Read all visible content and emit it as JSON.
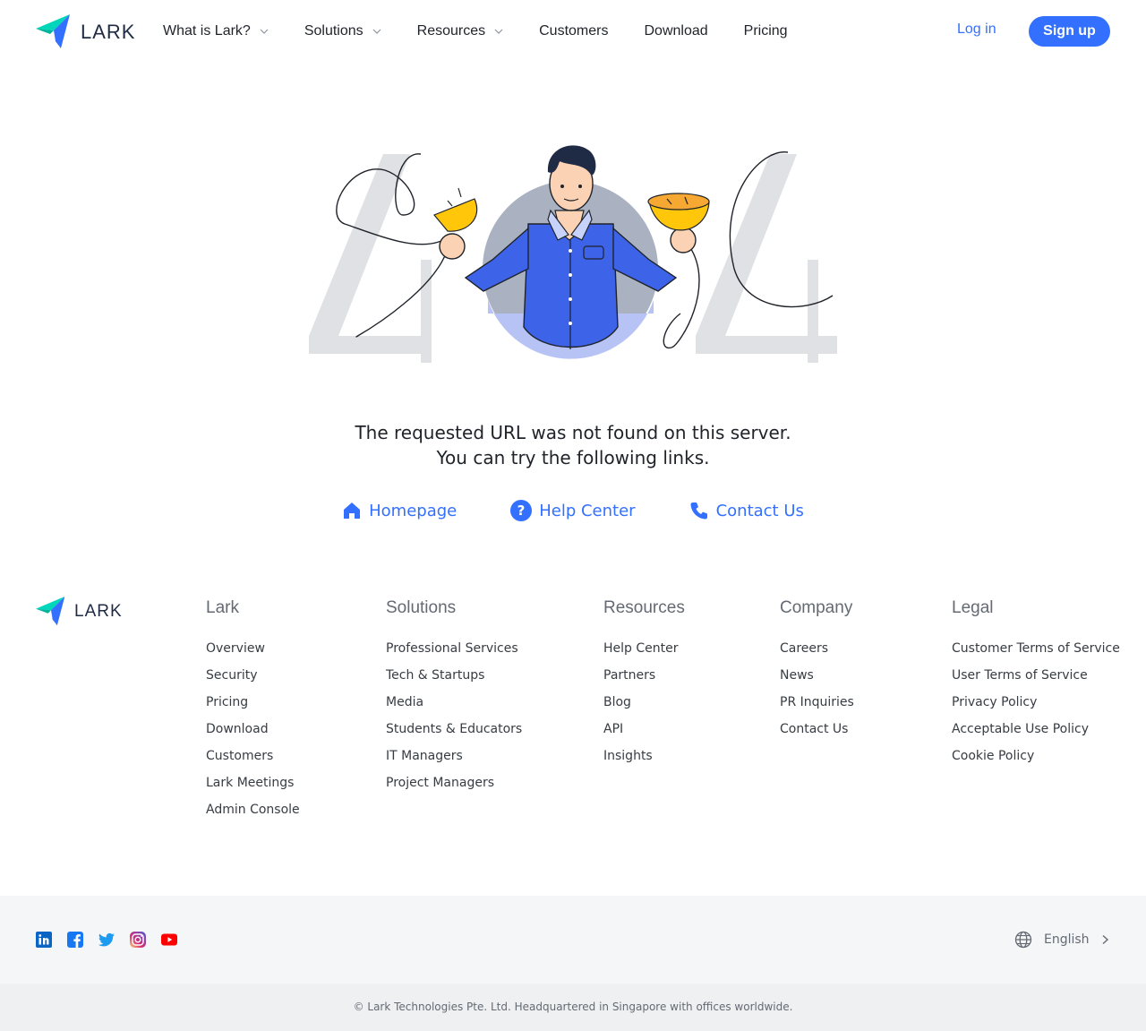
{
  "header": {
    "logo_text": "LARK",
    "nav": [
      {
        "label": "What is Lark?",
        "dropdown": true
      },
      {
        "label": "Solutions",
        "dropdown": true
      },
      {
        "label": "Resources",
        "dropdown": true
      },
      {
        "label": "Customers",
        "dropdown": false
      },
      {
        "label": "Download",
        "dropdown": false
      },
      {
        "label": "Pricing",
        "dropdown": false
      }
    ],
    "login_label": "Log in",
    "signup_label": "Sign up"
  },
  "error": {
    "line1": "The requested URL was not found on this server.",
    "line2": "You can try the following links.",
    "links": [
      {
        "label": "Homepage",
        "icon": "home-icon"
      },
      {
        "label": "Help Center",
        "icon": "question-icon"
      },
      {
        "label": "Contact Us",
        "icon": "phone-icon"
      }
    ]
  },
  "footer": {
    "logo_text": "LARK",
    "columns": [
      {
        "title": "Lark",
        "items": [
          "Overview",
          "Security",
          "Pricing",
          "Download",
          "Customers",
          "Lark Meetings",
          "Admin Console"
        ]
      },
      {
        "title": "Solutions",
        "items": [
          "Professional Services",
          "Tech & Startups",
          "Media",
          "Students & Educators",
          "IT Managers",
          "Project Managers"
        ]
      },
      {
        "title": "Resources",
        "items": [
          "Help Center",
          "Partners",
          "Blog",
          "API",
          "Insights"
        ]
      },
      {
        "title": "Company",
        "items": [
          "Careers",
          "News",
          "PR Inquiries",
          "Contact Us"
        ]
      },
      {
        "title": "Legal",
        "items": [
          "Customer Terms of Service",
          "User Terms of Service",
          "Privacy Policy",
          "Acceptable Use Policy",
          "Cookie Policy"
        ]
      }
    ],
    "social": [
      "linkedin-icon",
      "facebook-icon",
      "twitter-icon",
      "instagram-icon",
      "youtube-icon"
    ],
    "language": "English",
    "copyright": "© Lark Technologies Pte. Ltd. Headquartered in Singapore with offices worldwide."
  },
  "colors": {
    "accent": "#3370ff",
    "text": "#1f2329",
    "muted": "#646a73"
  }
}
